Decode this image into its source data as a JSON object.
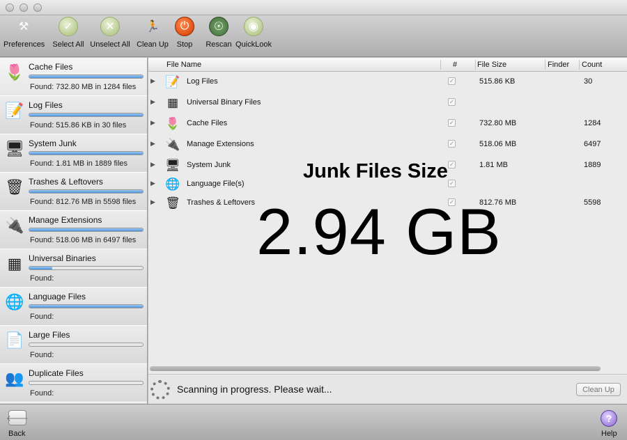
{
  "toolbar": {
    "buttons": [
      {
        "label": "Preferences",
        "icon": "tools-icon"
      },
      {
        "label": "Select All",
        "icon": "checkmark-icon"
      },
      {
        "label": "Unselect All",
        "icon": "x-icon"
      },
      {
        "label": "Clean Up",
        "icon": "running-man-icon"
      },
      {
        "label": "Stop",
        "icon": "power-icon"
      },
      {
        "label": "Rescan",
        "icon": "radar-icon"
      },
      {
        "label": "QuickLook",
        "icon": "eye-icon"
      }
    ]
  },
  "sidebar": {
    "items": [
      {
        "title": "Cache Files",
        "found": "Found: 732.80 MB in 1284 files",
        "progress": 1.0,
        "icon": "cache-icon",
        "active": true
      },
      {
        "title": "Log Files",
        "found": "Found: 515.86 KB in 30 files",
        "progress": 1.0,
        "icon": "log-icon"
      },
      {
        "title": "System Junk",
        "found": "Found: 1.81 MB in 1889 files",
        "progress": 1.0,
        "icon": "monitor-icon"
      },
      {
        "title": "Trashes & Leftovers",
        "found": "Found: 812.76 MB in 5598 files",
        "progress": 1.0,
        "icon": "trash-icon"
      },
      {
        "title": "Manage Extensions",
        "found": "Found: 518.06 MB in 6497 files",
        "progress": 1.0,
        "icon": "plug-icon"
      },
      {
        "title": "Universal Binaries",
        "found": "Found:",
        "progress": 0.2,
        "icon": "binary-grid-icon"
      },
      {
        "title": "Language Files",
        "found": "Found:",
        "progress": 1.0,
        "icon": "globe-icon"
      },
      {
        "title": "Large Files",
        "found": "Found:",
        "progress": 0.0,
        "icon": "document-icon"
      },
      {
        "title": "Duplicate Files",
        "found": "Found:",
        "progress": 0.0,
        "icon": "people-icon"
      }
    ]
  },
  "table": {
    "headers": {
      "name": "File Name",
      "check": "#",
      "size": "File Size",
      "finder": "Finder",
      "count": "Count"
    },
    "rows": [
      {
        "name": "Log Files",
        "size": "515.86 KB",
        "count": "30",
        "icon": "log-icon"
      },
      {
        "name": "Universal Binary Files",
        "size": "",
        "count": "",
        "icon": "binary-grid-icon"
      },
      {
        "name": "Cache Files",
        "size": "732.80 MB",
        "count": "1284",
        "icon": "cache-icon"
      },
      {
        "name": "Manage Extensions",
        "size": "518.06 MB",
        "count": "6497",
        "icon": "plug-icon"
      },
      {
        "name": "System Junk",
        "size": "1.81 MB",
        "count": "1889",
        "icon": "monitor-icon"
      },
      {
        "name": "Language File(s)",
        "size": "",
        "count": "",
        "icon": "globe-icon"
      },
      {
        "name": "Trashes & Leftovers",
        "size": "812.76 MB",
        "count": "5598",
        "icon": "trash-icon"
      }
    ]
  },
  "overlay": {
    "title": "Junk Files Size",
    "size": "2.94 GB"
  },
  "status": {
    "text": "Scanning in progress. Please wait...",
    "button": "Clean Up"
  },
  "bottom": {
    "back": "Back",
    "help": "Help"
  }
}
